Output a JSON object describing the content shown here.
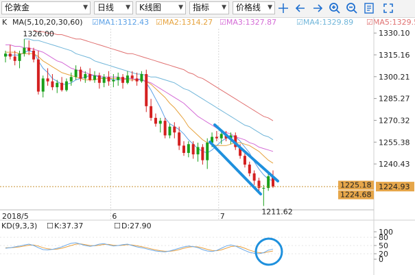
{
  "toolbar": {
    "instrument": "伦敦金",
    "period": "日线",
    "chart_type": "K线图",
    "indicator": "指标",
    "price_mode": "价格线",
    "icons": [
      "crosshair-icon",
      "arrow-left-icon",
      "arrow-right-icon",
      "zoom-in-icon",
      "zoom-out-icon",
      "settings-icon",
      "expand-icon"
    ]
  },
  "ma_legend": {
    "prefix": "K",
    "params": "MA(5,10,20,30,60)",
    "items": [
      {
        "label": "MA1:1312.43",
        "color": "#5aa0e6"
      },
      {
        "label": "MA2:1314.27",
        "color": "#e6a23c"
      },
      {
        "label": "MA3:1327.87",
        "color": "#d46ad6"
      },
      {
        "label": "MA4:1329.89",
        "color": "#6fb5d9"
      },
      {
        "label": "MA5:1329.5",
        "color": "#e07070"
      }
    ]
  },
  "kd_legend": {
    "params": "KD(9,3,3)",
    "k": "K:37.37",
    "d": "D:27.90",
    "k_color": "#6aa8e8",
    "d_color": "#e8a040"
  },
  "annotations": {
    "high_label": "1326.00",
    "low_label": "1211.62"
  },
  "price_tags": {
    "upper": "1225.18",
    "lower": "1224.68",
    "current": "1224.93",
    "tag_color": "#e6a64a"
  },
  "colors": {
    "up": "#1aa01a",
    "down": "#d42020",
    "channel": "#1e90dd",
    "circle": "#1e90dd"
  },
  "chart_data": {
    "type": "candlestick",
    "x_labels": [
      "2018/5",
      "6",
      "7"
    ],
    "x_label_index": [
      0,
      23,
      46
    ],
    "y_ticks": [
      1330.1,
      1315.16,
      1300.21,
      1285.27,
      1270.32,
      1255.38,
      1240.43
    ],
    "ylim": [
      1209,
      1333
    ],
    "candles": [
      [
        1314,
        1318,
        1310,
        1316
      ],
      [
        1316,
        1322,
        1312,
        1314
      ],
      [
        1314,
        1318,
        1308,
        1311
      ],
      [
        1311,
        1318,
        1306,
        1316
      ],
      [
        1316,
        1326,
        1314,
        1320
      ],
      [
        1320,
        1325,
        1315,
        1318
      ],
      [
        1318,
        1320,
        1310,
        1312
      ],
      [
        1312,
        1318,
        1288,
        1290
      ],
      [
        1290,
        1301,
        1286,
        1299
      ],
      [
        1299,
        1306,
        1294,
        1297
      ],
      [
        1297,
        1302,
        1291,
        1293
      ],
      [
        1293,
        1298,
        1289,
        1296
      ],
      [
        1296,
        1300,
        1290,
        1291
      ],
      [
        1291,
        1299,
        1290,
        1297
      ],
      [
        1297,
        1303,
        1294,
        1300
      ],
      [
        1300,
        1308,
        1298,
        1305
      ],
      [
        1305,
        1307,
        1297,
        1299
      ],
      [
        1299,
        1304,
        1296,
        1302
      ],
      [
        1302,
        1306,
        1297,
        1298
      ],
      [
        1298,
        1304,
        1296,
        1301
      ],
      [
        1301,
        1303,
        1292,
        1296
      ],
      [
        1296,
        1302,
        1293,
        1300
      ],
      [
        1300,
        1304,
        1294,
        1297
      ],
      [
        1297,
        1302,
        1293,
        1298
      ],
      [
        1298,
        1303,
        1294,
        1300
      ],
      [
        1300,
        1302,
        1292,
        1296
      ],
      [
        1296,
        1304,
        1295,
        1301
      ],
      [
        1301,
        1304,
        1297,
        1299
      ],
      [
        1299,
        1303,
        1294,
        1297
      ],
      [
        1297,
        1304,
        1296,
        1302
      ],
      [
        1302,
        1305,
        1276,
        1280
      ],
      [
        1280,
        1285,
        1270,
        1272
      ],
      [
        1272,
        1275,
        1266,
        1268
      ],
      [
        1268,
        1272,
        1262,
        1270
      ],
      [
        1270,
        1272,
        1258,
        1260
      ],
      [
        1260,
        1268,
        1258,
        1266
      ],
      [
        1266,
        1269,
        1258,
        1262
      ],
      [
        1262,
        1266,
        1250,
        1253
      ],
      [
        1253,
        1256,
        1246,
        1248
      ],
      [
        1248,
        1256,
        1245,
        1254
      ],
      [
        1254,
        1256,
        1244,
        1247
      ],
      [
        1247,
        1255,
        1242,
        1252
      ],
      [
        1252,
        1254,
        1240,
        1243
      ],
      [
        1243,
        1258,
        1237,
        1255
      ],
      [
        1255,
        1262,
        1252,
        1259
      ],
      [
        1259,
        1263,
        1256,
        1258
      ],
      [
        1258,
        1262,
        1254,
        1261
      ],
      [
        1261,
        1263,
        1256,
        1258
      ],
      [
        1258,
        1262,
        1254,
        1260
      ],
      [
        1260,
        1262,
        1250,
        1252
      ],
      [
        1252,
        1254,
        1244,
        1246
      ],
      [
        1246,
        1248,
        1238,
        1240
      ],
      [
        1240,
        1242,
        1232,
        1234
      ],
      [
        1234,
        1236,
        1226,
        1229
      ],
      [
        1229,
        1231,
        1222,
        1224
      ],
      [
        1224,
        1226,
        1211.62,
        1224
      ],
      [
        1224,
        1235,
        1222,
        1232
      ],
      [
        1232,
        1236,
        1224,
        1225
      ]
    ],
    "ma_series": [
      {
        "name": "MA1",
        "color": "#5aa0e6",
        "values": [
          1315,
          1315,
          1315,
          1315,
          1317,
          1318,
          1317,
          1311,
          1306,
          1303,
          1299,
          1297,
          1295,
          1295,
          1296,
          1298,
          1299,
          1300,
          1301,
          1301,
          1300,
          1299,
          1299,
          1298,
          1298,
          1298,
          1299,
          1299,
          1298,
          1299,
          1296,
          1291,
          1285,
          1279,
          1272,
          1268,
          1266,
          1264,
          1261,
          1257,
          1254,
          1251,
          1249,
          1248,
          1250,
          1253,
          1256,
          1258,
          1259,
          1259,
          1256,
          1252,
          1248,
          1242,
          1237,
          1233,
          1230,
          1229
        ]
      },
      {
        "name": "MA2",
        "color": "#e6a23c",
        "values": [
          1317,
          1317,
          1317,
          1316,
          1316,
          1316,
          1316,
          1314,
          1311,
          1309,
          1307,
          1305,
          1303,
          1302,
          1301,
          1300,
          1299,
          1298,
          1298,
          1298,
          1299,
          1299,
          1299,
          1299,
          1299,
          1299,
          1298,
          1298,
          1298,
          1298,
          1297,
          1295,
          1292,
          1289,
          1286,
          1282,
          1279,
          1275,
          1271,
          1266,
          1263,
          1260,
          1257,
          1255,
          1254,
          1253,
          1253,
          1253,
          1254,
          1255,
          1255,
          1254,
          1253,
          1251,
          1249,
          1246,
          1243,
          1241
        ]
      },
      {
        "name": "MA3",
        "color": "#d46ad6",
        "values": [
          1322,
          1322,
          1321,
          1321,
          1320,
          1320,
          1319,
          1318,
          1317,
          1315,
          1313,
          1311,
          1310,
          1308,
          1306,
          1305,
          1304,
          1303,
          1302,
          1301,
          1301,
          1300,
          1300,
          1300,
          1300,
          1299,
          1299,
          1299,
          1298,
          1298,
          1297,
          1296,
          1294,
          1292,
          1290,
          1288,
          1286,
          1284,
          1282,
          1279,
          1276,
          1273,
          1271,
          1269,
          1267,
          1265,
          1263,
          1262,
          1261,
          1259,
          1258,
          1257,
          1255,
          1254,
          1252,
          1251,
          1250,
          1249
        ]
      },
      {
        "name": "MA4",
        "color": "#6fb5d9",
        "values": [
          1326,
          1326,
          1325,
          1325,
          1324,
          1323,
          1322,
          1321,
          1320,
          1319,
          1318,
          1316,
          1315,
          1314,
          1313,
          1311,
          1310,
          1309,
          1308,
          1307,
          1306,
          1305,
          1304,
          1303,
          1302,
          1302,
          1301,
          1300,
          1300,
          1299,
          1298,
          1297,
          1296,
          1294,
          1292,
          1291,
          1289,
          1287,
          1285,
          1283,
          1281,
          1279,
          1277,
          1275,
          1273,
          1271,
          1269,
          1267,
          1266,
          1264,
          1262,
          1260,
          1259,
          1257
        ]
      },
      {
        "name": "MA5",
        "color": "#e07070",
        "values": [
          1332,
          1331,
          1331,
          1330,
          1330,
          1329,
          1329,
          1328,
          1327,
          1326,
          1326,
          1325,
          1324,
          1323,
          1322,
          1321,
          1320,
          1319,
          1318,
          1317,
          1316,
          1316,
          1315,
          1314,
          1313,
          1312,
          1311,
          1310,
          1309,
          1308,
          1307,
          1306,
          1305,
          1303,
          1302,
          1300,
          1299,
          1297,
          1295,
          1293,
          1291,
          1289,
          1287,
          1285,
          1283,
          1281,
          1279,
          1277,
          1275,
          1273,
          1272,
          1270
        ]
      }
    ],
    "kd_ylim": [
      0,
      100
    ],
    "kd_ticks": [
      100,
      80,
      50,
      20,
      0
    ],
    "kd_k": [
      40,
      42,
      45,
      48,
      52,
      55,
      50,
      42,
      35,
      34,
      36,
      40,
      45,
      52,
      58,
      60,
      55,
      50,
      47,
      50,
      55,
      57,
      52,
      48,
      50,
      53,
      55,
      50,
      45,
      42,
      38,
      34,
      30,
      28,
      27,
      30,
      35,
      40,
      45,
      48,
      46,
      42,
      35,
      30,
      28,
      32,
      40,
      48,
      52,
      48,
      40,
      32,
      25,
      22,
      20,
      24,
      33,
      37
    ],
    "kd_d": [
      42,
      42,
      43,
      45,
      48,
      51,
      52,
      48,
      42,
      38,
      36,
      37,
      40,
      45,
      50,
      55,
      56,
      53,
      50,
      49,
      51,
      54,
      54,
      51,
      50,
      51,
      53,
      52,
      49,
      46,
      42,
      38,
      34,
      31,
      29,
      29,
      31,
      35,
      40,
      44,
      46,
      45,
      41,
      36,
      32,
      31,
      34,
      40,
      46,
      48,
      46,
      40,
      33,
      28,
      24,
      23,
      27,
      30
    ]
  }
}
